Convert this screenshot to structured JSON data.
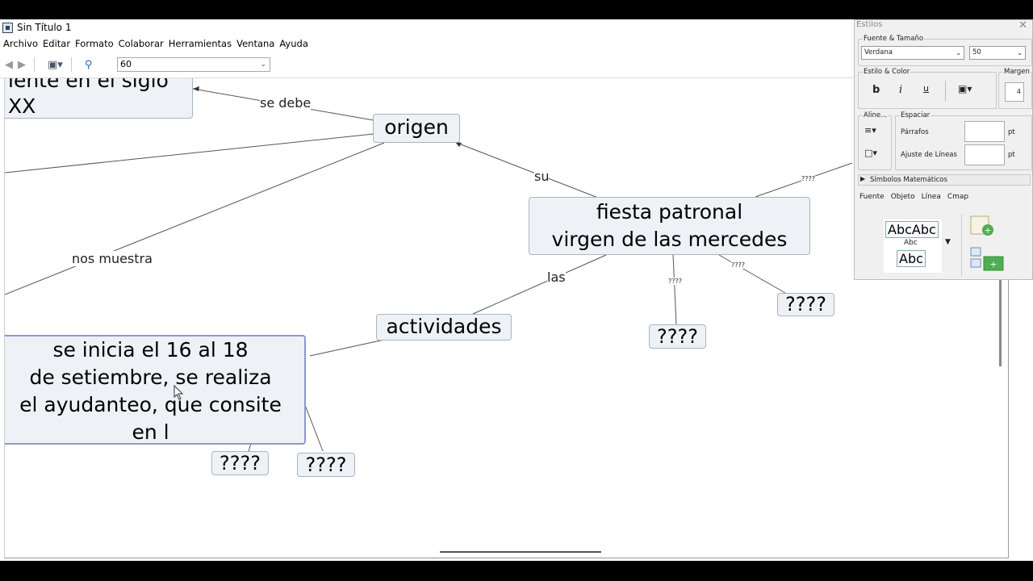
{
  "window": {
    "title": "Sin Título 1"
  },
  "menu": [
    "Archivo",
    "Editar",
    "Formato",
    "Colaborar",
    "Herramientas",
    "Ventana",
    "Ayuda"
  ],
  "toolbar": {
    "zoom_value": "60"
  },
  "map": {
    "nodes": {
      "top_left": "iente en el siglo\nXX",
      "origen": "origen",
      "fiesta": "fiesta patronal\nvirgen de las mercedes",
      "actividades": "actividades",
      "q1": "????",
      "q2": "????",
      "se_inicia": "se inicia el 16 al 18\nde setiembre, se realiza\nel ayudanteo, que consite\nen l",
      "q3": "????",
      "q4": "????"
    },
    "links": {
      "se_debe": "se debe",
      "su": "su",
      "nos_muestra": "nos muestra",
      "las": "las",
      "q_small1": "????",
      "q_small2": "????",
      "q_small3": "????"
    }
  },
  "styles_panel": {
    "title": "Estilos",
    "font_size_group": "Fuente & Tamaño",
    "font": "Verdana",
    "size": "50",
    "style_color_group": "Estilo & Color",
    "bold": "b",
    "italic": "i",
    "underline": "u",
    "margin_group": "Margen",
    "margin_value": "4",
    "align_group": "Aline...",
    "spacing_group": "Espaciar",
    "paragraphs": "Párrafos",
    "line_spacing": "Ajuste de Líneas",
    "unit_pt": "pt",
    "math_symbols": "Símbolos Matemáticos",
    "tabs": [
      "Fuente",
      "Objeto",
      "Línea",
      "Cmap"
    ],
    "abc_samples": [
      "AbcAbc",
      "Abc",
      "Abc"
    ]
  }
}
